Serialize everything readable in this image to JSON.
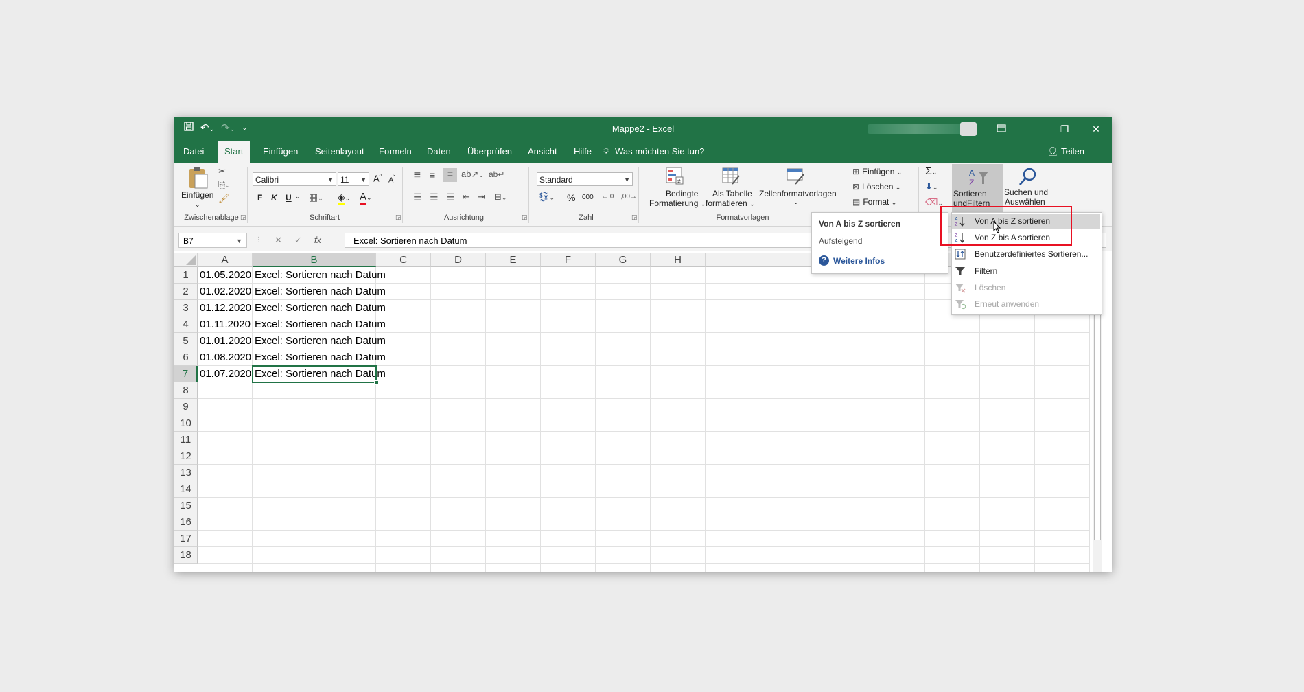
{
  "window": {
    "title": "Mappe2  -  Excel",
    "share_label": "Teilen",
    "tell_me": "Was möchten Sie tun?"
  },
  "tabs": [
    "Datei",
    "Start",
    "Einfügen",
    "Seitenlayout",
    "Formeln",
    "Daten",
    "Überprüfen",
    "Ansicht",
    "Hilfe"
  ],
  "active_tab": "Start",
  "ribbon": {
    "clipboard": {
      "paste_label": "Einfügen",
      "group": "Zwischenablage"
    },
    "font": {
      "family": "Calibri",
      "size": "11",
      "bold": "F",
      "italic": "K",
      "underline": "U",
      "group": "Schriftart"
    },
    "alignment": {
      "group": "Ausrichtung"
    },
    "number": {
      "format": "Standard",
      "percent": "%",
      "thousands": "000",
      "group": "Zahl"
    },
    "styles": {
      "conditional_l1": "Bedingte",
      "conditional_l2": "Formatierung",
      "table_l1": "Als Tabelle",
      "table_l2": "formatieren",
      "cellstyles": "Zellenformatvorlagen",
      "group": "Formatvorlagen"
    },
    "cells": {
      "insert": "Einfügen",
      "delete": "Löschen",
      "format": "Format"
    },
    "editing": {
      "sort_l1": "Sortieren und",
      "sort_l2": "Filtern",
      "find_l1": "Suchen und",
      "find_l2": "Auswählen"
    }
  },
  "formula_bar": {
    "name_box": "B7",
    "fx": "fx",
    "content": "Excel: Sortieren nach Datum"
  },
  "columns": [
    "A",
    "B",
    "C",
    "D",
    "E",
    "F",
    "G",
    "H"
  ],
  "rows": [
    "1",
    "2",
    "3",
    "4",
    "5",
    "6",
    "7",
    "8",
    "9",
    "10",
    "11",
    "12",
    "13",
    "14",
    "15",
    "16",
    "17",
    "18"
  ],
  "cells": [
    {
      "a": "01.05.2020",
      "b": "Excel: Sortieren nach Datum"
    },
    {
      "a": "01.02.2020",
      "b": "Excel: Sortieren nach Datum"
    },
    {
      "a": "01.12.2020",
      "b": "Excel: Sortieren nach Datum"
    },
    {
      "a": "01.11.2020",
      "b": "Excel: Sortieren nach Datum"
    },
    {
      "a": "01.01.2020",
      "b": "Excel: Sortieren nach Datum"
    },
    {
      "a": "01.08.2020",
      "b": "Excel: Sortieren nach Datum"
    },
    {
      "a": "01.07.2020",
      "b": "Excel: Sortieren nach Datum"
    }
  ],
  "tooltip": {
    "title": "Von A bis Z sortieren",
    "description": "Aufsteigend",
    "more": "Weitere Infos"
  },
  "sort_menu": [
    {
      "label": "Von A bis Z sortieren",
      "icon": "sort-az-icon",
      "state": "hover"
    },
    {
      "label": "Von Z bis A sortieren",
      "icon": "sort-za-icon",
      "state": "normal"
    },
    {
      "label": "Benutzerdefiniertes Sortieren...",
      "icon": "custom-sort-icon",
      "state": "normal"
    },
    {
      "label": "Filtern",
      "icon": "filter-icon",
      "state": "normal"
    },
    {
      "label": "Löschen",
      "icon": "clear-filter-icon",
      "state": "disabled"
    },
    {
      "label": "Erneut anwenden",
      "icon": "reapply-icon",
      "state": "disabled"
    }
  ],
  "colors": {
    "accent": "#217346",
    "highlight": "#e81123",
    "link": "#2b579a"
  }
}
